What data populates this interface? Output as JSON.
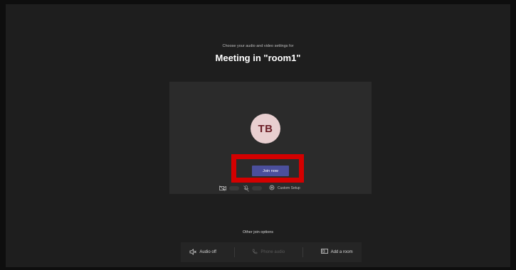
{
  "prejoin": {
    "subtitle": "Choose your audio and video settings for",
    "title": "Meeting in \"room1\""
  },
  "preview": {
    "avatar_initials": "TB",
    "join_label": "Join now",
    "custom_setup_label": "Custom Setup"
  },
  "other_options": {
    "heading": "Other join options",
    "items": [
      {
        "label": "Audio off",
        "icon": "speaker-off-icon",
        "enabled": true
      },
      {
        "label": "Phone audio",
        "icon": "phone-icon",
        "enabled": false
      },
      {
        "label": "Add a room",
        "icon": "cast-room-icon",
        "enabled": true
      }
    ]
  },
  "colors": {
    "background": "#1e1e1e",
    "preview_bg": "#2b2b2b",
    "join_button": "#4b4f9c",
    "avatar_bg": "#e8cfd0",
    "avatar_text": "#6b1e26",
    "highlight": "#d40000"
  }
}
